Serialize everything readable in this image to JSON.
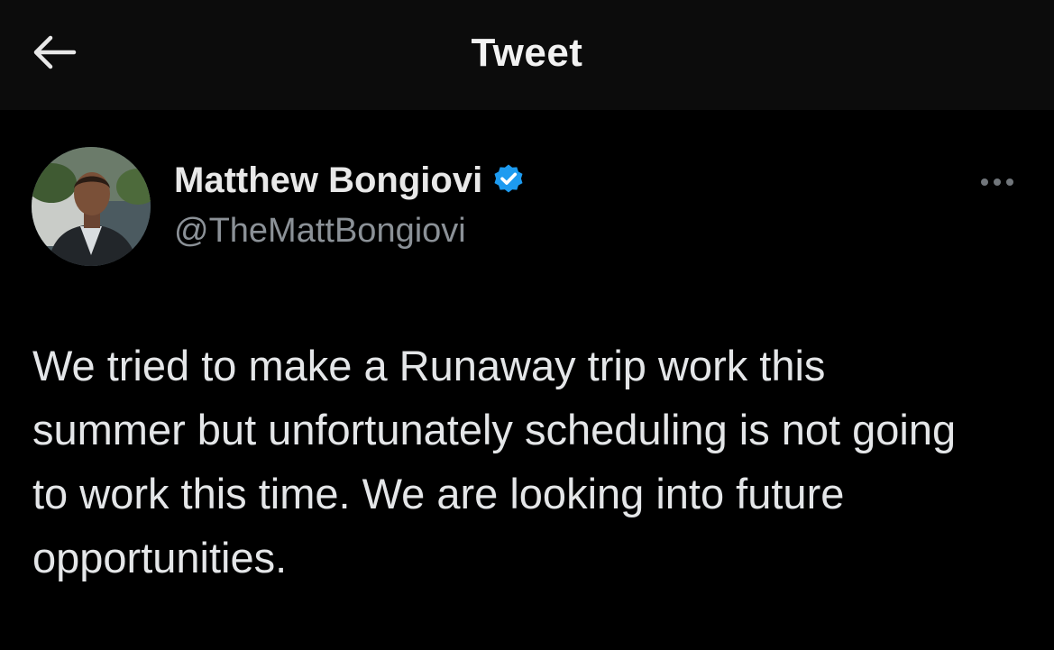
{
  "header": {
    "back_icon": "arrow-left-icon",
    "title": "Tweet"
  },
  "tweet": {
    "author": {
      "name": "Matthew Bongiovi",
      "handle": "@TheMattBongiovi",
      "verified": true,
      "verified_icon": "verified-badge-icon",
      "verified_color": "#1d9bf0"
    },
    "more_icon": "more-horizontal-icon",
    "text": "We tried to make a Runaway trip work this summer but unfortunately scheduling is not going to work this time. We are looking into future opportunities."
  },
  "colors": {
    "background": "#000000",
    "header_background": "#0c0c0c",
    "text_primary": "#e7e9ea",
    "text_secondary": "#8b9197"
  }
}
